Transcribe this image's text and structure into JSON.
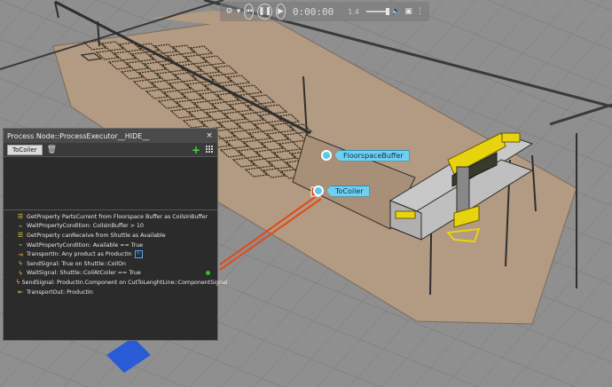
{
  "playback": {
    "time": "0:00:00",
    "speed": "1.4",
    "icons": [
      "gear-icon",
      "rewind-icon",
      "pause-icon",
      "play-icon",
      "volume-icon",
      "image-icon",
      "more-icon"
    ]
  },
  "scene": {
    "callouts": [
      {
        "label": "FloorspaceBuffer"
      },
      {
        "label": "ToCoiler"
      }
    ],
    "colors": {
      "floor": "#b39a82",
      "grid": "#8e8e8e",
      "gantry": "#e8d40e",
      "rail": "#3a3a3a",
      "path": "#e04a1a",
      "callout": "#6fd0f2"
    }
  },
  "panel": {
    "title": "Process Node::ProcessExecutor__HIDE__",
    "close": "×",
    "tab": "ToCoiler",
    "add": "+",
    "statements": [
      {
        "icon": "get-property-icon",
        "text": "GetProperty PartsCurrent from Floorspace Buffer as CoilsInBuffer"
      },
      {
        "icon": "wait-property-icon",
        "text": "WaitPropertyCondition: CoilsInBuffer > 10"
      },
      {
        "icon": "get-property-icon",
        "text": "GetProperty canReceive from Shuttle as Available"
      },
      {
        "icon": "wait-property-icon",
        "text": "WaitPropertyCondition: Available == True"
      },
      {
        "icon": "transport-in-icon",
        "text": "TransportIn: Any product as ProductIn"
      },
      {
        "icon": "send-signal-icon",
        "text": "SendSignal: True on Shuttle::CoilOn"
      },
      {
        "icon": "wait-signal-icon",
        "text": "WaitSignal: Shuttle::CoilAtCoiler == True"
      },
      {
        "icon": "send-signal-icon",
        "text": "SendSignal: ProductIn.Component on CutToLenghtLine::ComponentSignal"
      },
      {
        "icon": "transport-out-icon",
        "text": "TransportOut: ProductIn"
      }
    ]
  }
}
